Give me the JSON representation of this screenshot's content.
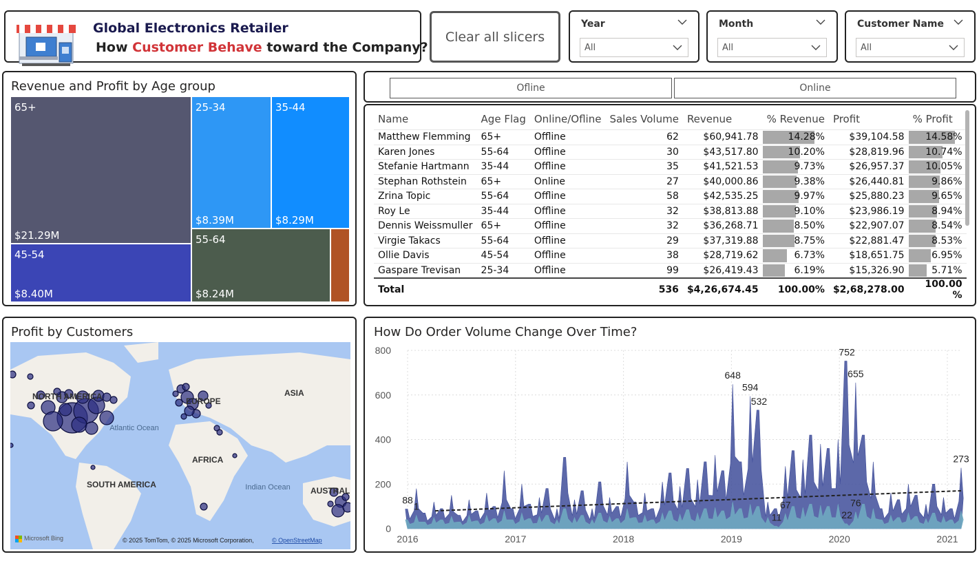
{
  "header": {
    "title": "Global Electronics Retailer",
    "subtitle_pre": "How ",
    "subtitle_highlight": "Customer Behave",
    "subtitle_post": " toward the Company?"
  },
  "clear_button": "Clear all slicers",
  "slicers": [
    {
      "label": "Year",
      "value": "All"
    },
    {
      "label": "Month",
      "value": "All"
    },
    {
      "label": "Customer Name",
      "value": "All"
    }
  ],
  "treemap": {
    "title": "Revenue and Profit by Age group",
    "cells": [
      {
        "label": "65+",
        "value": "$21.29M",
        "color": "#555770"
      },
      {
        "label": "25-34",
        "value": "$8.39M",
        "color": "#2e97f5"
      },
      {
        "label": "35-44",
        "value": "$8.29M",
        "color": "#118dff"
      },
      {
        "label": "45-54",
        "value": "$8.40M",
        "color": "#3b45b5"
      },
      {
        "label": "55-64",
        "value": "$8.24M",
        "color": "#4c5c4d"
      },
      {
        "label": "",
        "value": "",
        "color": "#b05325"
      }
    ]
  },
  "tabs": [
    "Ofline",
    "Online"
  ],
  "table": {
    "columns": [
      "Name",
      "Age Flag",
      "Online/Ofline",
      "Sales Volume",
      "Revenue",
      "% Revenue",
      "Profit",
      "% Profit"
    ],
    "rows": [
      [
        "Matthew Flemming",
        "65+",
        "Offline",
        "62",
        "$60,941.78",
        "14.28%",
        "$39,104.58",
        "14.58%"
      ],
      [
        "Karen Jones",
        "55-64",
        "Offline",
        "30",
        "$43,517.80",
        "10.20%",
        "$28,819.96",
        "10.74%"
      ],
      [
        "Stefanie Hartmann",
        "35-44",
        "Offline",
        "35",
        "$41,521.53",
        "9.73%",
        "$26,957.37",
        "10.05%"
      ],
      [
        "Stephan Rothstein",
        "65+",
        "Online",
        "27",
        "$40,000.86",
        "9.38%",
        "$26,440.81",
        "9.86%"
      ],
      [
        "Zrina Topic",
        "55-64",
        "Offline",
        "58",
        "$42,535.25",
        "9.97%",
        "$25,880.23",
        "9.65%"
      ],
      [
        "Roy Le",
        "35-44",
        "Offline",
        "32",
        "$38,813.88",
        "9.10%",
        "$23,986.19",
        "8.94%"
      ],
      [
        "Dennis Weissmuller",
        "65+",
        "Offline",
        "32",
        "$36,268.71",
        "8.50%",
        "$22,907.07",
        "8.54%"
      ],
      [
        "Virgie Takacs",
        "55-64",
        "Offline",
        "29",
        "$37,319.88",
        "8.75%",
        "$22,881.47",
        "8.53%"
      ],
      [
        "Ollie Davis",
        "45-54",
        "Offline",
        "38",
        "$28,719.62",
        "6.73%",
        "$18,651.75",
        "6.95%"
      ],
      [
        "Gaspare Trevisan",
        "25-34",
        "Offline",
        "99",
        "$26,419.43",
        "6.19%",
        "$15,326.90",
        "5.71%"
      ]
    ],
    "total": [
      "Total",
      "",
      "",
      "536",
      "$4,26,674.45",
      "100.00%",
      "$2,68,278.00",
      "100.00 %"
    ]
  },
  "map": {
    "title": "Profit by Customers",
    "labels": [
      "NORTH AMERICA",
      "EUROPE",
      "ASIA",
      "Atlantic Ocean",
      "AFRICA",
      "SOUTH AMERICA",
      "Indian Ocean",
      "AUSTRALIA"
    ],
    "attribution": "© 2025 TomTom, © 2025 Microsoft Corporation,",
    "attribution_link": "© OpenStreetMap",
    "brand": "Microsoft Bing"
  },
  "chart_data": {
    "type": "area",
    "title": "How Do Order Volume Change Over Time?",
    "xlabel": "",
    "ylabel": "",
    "ylim": [
      0,
      800
    ],
    "y_ticks": [
      0,
      200,
      400,
      600,
      800
    ],
    "x_ticks": [
      "2016",
      "2017",
      "2018",
      "2019",
      "2020",
      "2021"
    ],
    "grid": true,
    "series": [
      {
        "values": [
          88,
          180,
          70,
          120,
          90,
          150,
          60,
          130,
          80,
          160,
          100,
          260,
          90,
          200,
          110,
          140,
          180,
          90,
          320,
          130,
          170,
          90,
          210,
          140,
          100,
          300,
          120,
          160,
          90,
          210,
          250,
          190,
          270,
          220,
          300,
          330,
          260,
          648,
          300,
          594,
          532,
          120,
          90,
          280,
          350,
          310,
          420,
          380,
          360,
          400,
          752,
          655,
          420,
          300,
          90,
          160,
          130,
          200,
          150,
          110,
          200,
          140,
          90,
          273
        ],
        "color": "#3f4d9a"
      },
      {
        "values": [
          40,
          60,
          30,
          50,
          40,
          55,
          30,
          60,
          35,
          60,
          45,
          80,
          40,
          70,
          45,
          55,
          60,
          40,
          90,
          50,
          60,
          40,
          70,
          55,
          45,
          90,
          50,
          60,
          40,
          70,
          80,
          65,
          85,
          70,
          90,
          95,
          80,
          120,
          90,
          110,
          100,
          50,
          11,
          67,
          100,
          95,
          110,
          105,
          100,
          110,
          22,
          76,
          110,
          90,
          40,
          60,
          50,
          70,
          55,
          45,
          70,
          55,
          40,
          80
        ],
        "color": "#6fa8c0"
      }
    ],
    "trend": {
      "start": 80,
      "end": 170
    },
    "annotations": [
      "88",
      "1",
      "648",
      "594",
      "532",
      "11",
      "67",
      "752",
      "655",
      "22",
      "76",
      "273"
    ]
  }
}
